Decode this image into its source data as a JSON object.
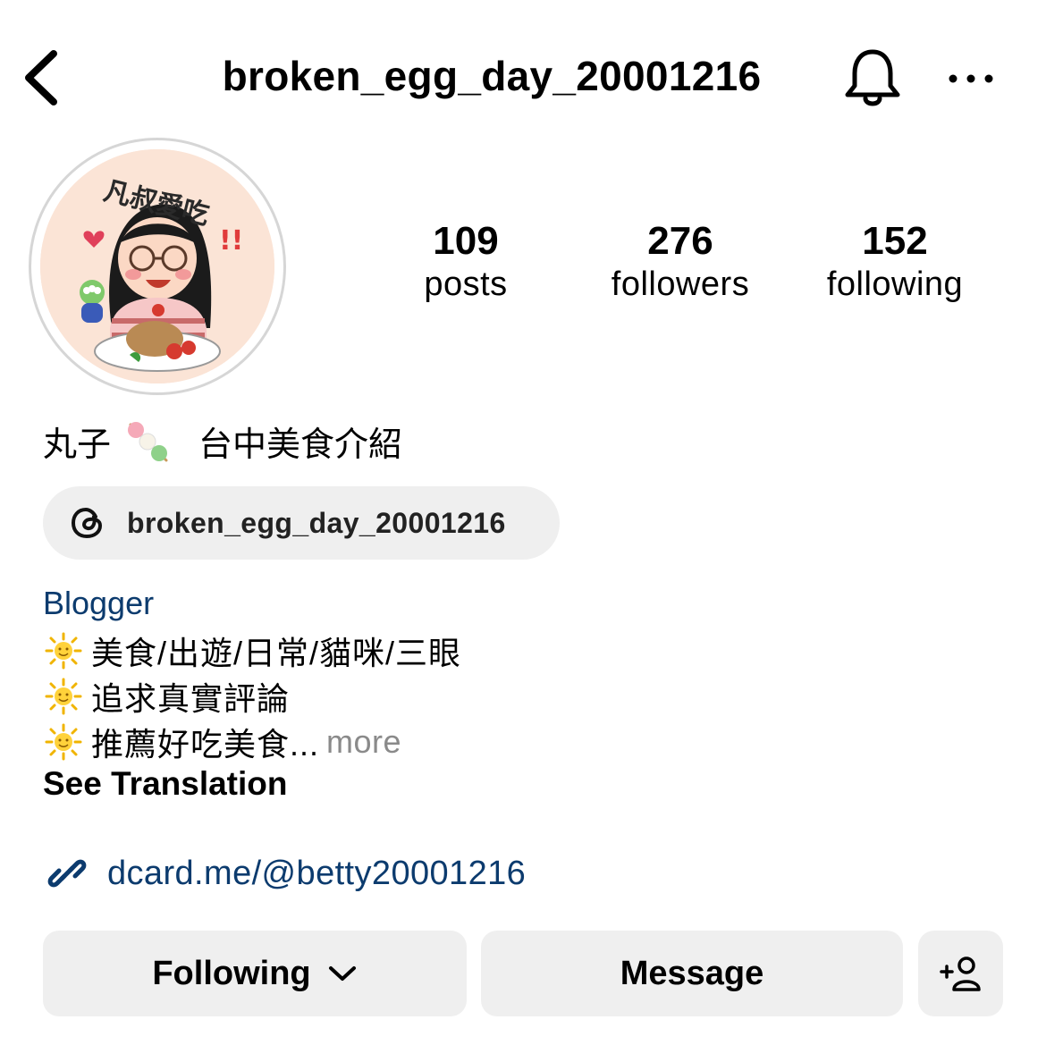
{
  "header": {
    "username": "broken_egg_day_20001216",
    "icons": [
      "back-icon",
      "bell-icon",
      "more-icon"
    ]
  },
  "profile": {
    "avatar_icon": "profile-illustration",
    "avatar_text": "凡叔愛吃!!",
    "stats": [
      {
        "value": "109",
        "label": "posts"
      },
      {
        "value": "276",
        "label": "followers"
      },
      {
        "value": "152",
        "label": "following"
      }
    ],
    "name_prefix": "丸子",
    "name_suffix": "台中美食介紹",
    "threads_handle": "broken_egg_day_20001216",
    "category": "Blogger",
    "bio_lines": [
      "美食/出遊/日常/貓咪/三眼",
      "追求真實評論",
      "推薦好吃美食..."
    ],
    "more_label": "more",
    "see_translation": "See Translation",
    "link": "dcard.me/@betty20001216"
  },
  "actions": {
    "following_label": "Following",
    "message_label": "Message"
  },
  "colors": {
    "link_blue": "#0c3b6e",
    "button_bg": "#efefef",
    "muted": "#8a8a8a"
  }
}
